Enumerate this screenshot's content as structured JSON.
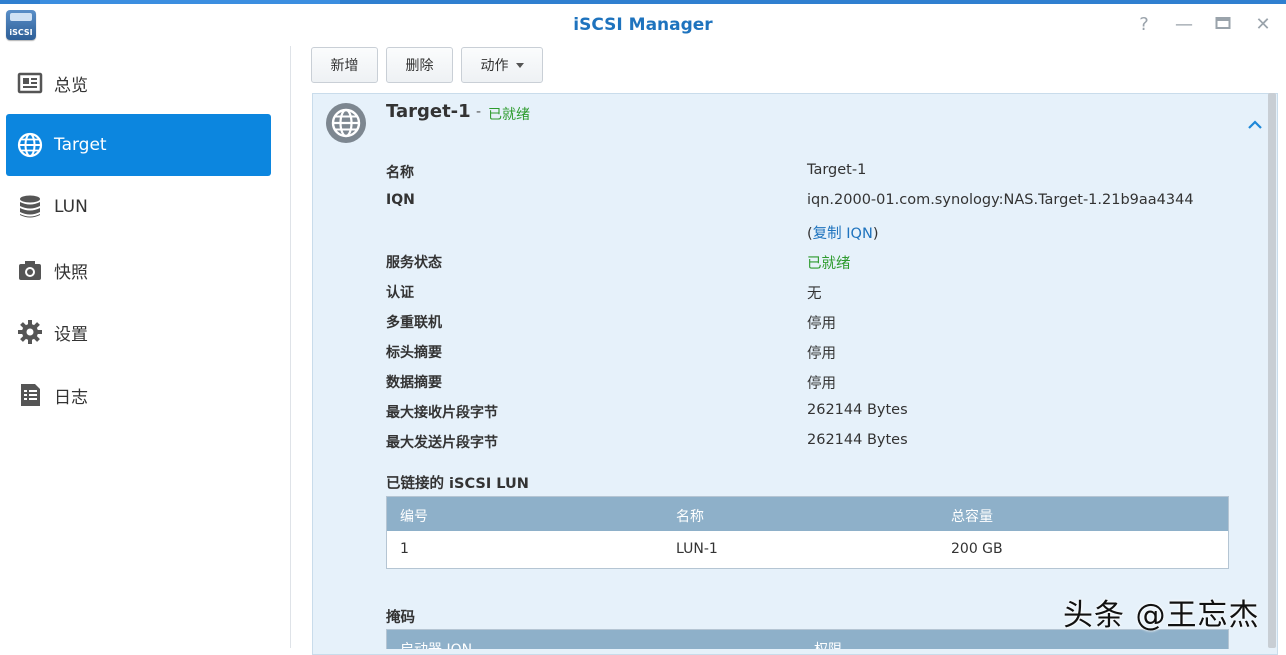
{
  "window": {
    "title": "iSCSI Manager",
    "app_icon_label": "iSCSI",
    "controls": {
      "help": "?",
      "minimize": "—",
      "maximize": "▭",
      "close": "✕"
    }
  },
  "sidebar": {
    "items": [
      {
        "label": "总览",
        "icon": "overview-icon",
        "active": false
      },
      {
        "label": "Target",
        "icon": "globe-icon",
        "active": true
      },
      {
        "label": "LUN",
        "icon": "database-icon",
        "active": false
      },
      {
        "label": "快照",
        "icon": "camera-icon",
        "active": false
      },
      {
        "label": "设置",
        "icon": "gear-icon",
        "active": false
      },
      {
        "label": "日志",
        "icon": "log-icon",
        "active": false
      }
    ]
  },
  "toolbar": {
    "add_label": "新增",
    "delete_label": "删除",
    "action_label": "动作"
  },
  "target": {
    "name": "Target-1",
    "separator": "-",
    "status": "已就绪",
    "details": [
      {
        "label": "名称",
        "value": "Target-1"
      },
      {
        "label": "IQN",
        "value": "iqn.2000-01.com.synology:NAS.Target-1.21b9aa4344"
      },
      {
        "label": "服务状态",
        "value": "已就绪"
      },
      {
        "label": "认证",
        "value": "无"
      },
      {
        "label": "多重联机",
        "value": "停用"
      },
      {
        "label": "标头摘要",
        "value": "停用"
      },
      {
        "label": "数据摘要",
        "value": "停用"
      },
      {
        "label": "最大接收片段字节",
        "value": "262144 Bytes"
      },
      {
        "label": "最大发送片段字节",
        "value": "262144 Bytes"
      }
    ],
    "copy_iqn": {
      "open": "(",
      "link": "复制 IQN",
      "close": ")"
    }
  },
  "linked_lun": {
    "title": "已链接的 iSCSI LUN",
    "columns": [
      "编号",
      "名称",
      "总容量"
    ],
    "rows": [
      {
        "number": "1",
        "name": "LUN-1",
        "capacity": "200 GB"
      }
    ]
  },
  "mask": {
    "title": "掩码",
    "columns": [
      "启动器 IQN",
      "权限"
    ]
  },
  "colors": {
    "accent": "#0c86df",
    "title_blue": "#1e73be",
    "status_green": "#2d9b2d",
    "panel_bg": "#e6f1fa",
    "table_header": "#8eb0c9"
  },
  "watermark": "头条 @王忘杰"
}
